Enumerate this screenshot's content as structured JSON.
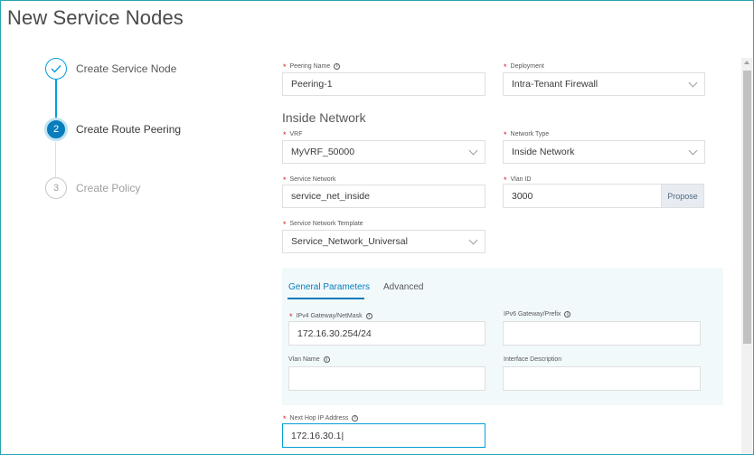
{
  "page": {
    "title": "New Service Nodes"
  },
  "wizard": {
    "steps": [
      {
        "number": "",
        "label": "Create Service Node",
        "state": "completed"
      },
      {
        "number": "2",
        "label": "Create Route Peering",
        "state": "active"
      },
      {
        "number": "3",
        "label": "Create Policy",
        "state": "pending"
      }
    ]
  },
  "form": {
    "peering_name": {
      "label": "Peering Name",
      "value": "Peering-1"
    },
    "deployment": {
      "label": "Deployment",
      "value": "Intra-Tenant Firewall"
    },
    "section_title": "Inside Network",
    "vrf": {
      "label": "VRF",
      "value": "MyVRF_50000"
    },
    "network_type": {
      "label": "Network Type",
      "value": "Inside Network"
    },
    "service_network": {
      "label": "Service Network",
      "value": "service_net_inside"
    },
    "vlan_id": {
      "label": "Vlan ID",
      "value": "3000",
      "button": "Propose"
    },
    "service_network_template": {
      "label": "Service Network Template",
      "value": "Service_Network_Universal"
    },
    "tabs": [
      {
        "label": "General Parameters",
        "active": true
      },
      {
        "label": "Advanced",
        "active": false
      }
    ],
    "ipv4_gateway": {
      "label": "IPv4 Gateway/NetMask",
      "value": "172.16.30.254/24"
    },
    "ipv6_gateway": {
      "label": "IPv6 Gateway/Prefix",
      "value": ""
    },
    "vlan_name": {
      "label": "Vlan Name",
      "value": ""
    },
    "interface_description": {
      "label": "Interface Description",
      "value": ""
    },
    "next_hop_ip": {
      "label": "Next Hop IP Address",
      "value": "172.16.30.1|"
    }
  },
  "colors": {
    "accent": "#049fd9",
    "active_step": "#097dbc",
    "required": "#cf2030",
    "panel_bg": "#f2f9fb"
  }
}
